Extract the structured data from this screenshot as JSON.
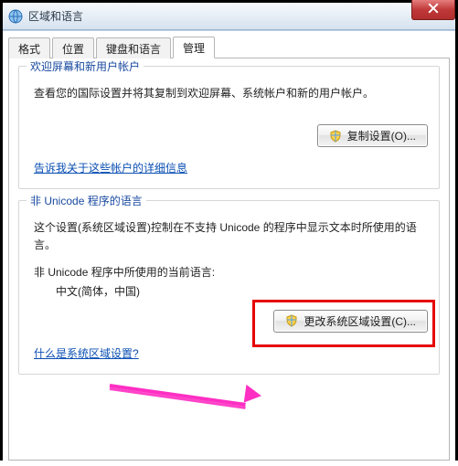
{
  "window": {
    "title": "区域和语言",
    "close_label": "X"
  },
  "tabs": {
    "format": "格式",
    "location": "位置",
    "keyboard": "键盘和语言",
    "admin": "管理"
  },
  "group1": {
    "title": "欢迎屏幕和新用户帐户",
    "desc": "查看您的国际设置并将其复制到欢迎屏幕、系统帐户和新的用户帐户。",
    "button": "复制设置(O)...",
    "link": "告诉我关于这些帐户的详细信息"
  },
  "group2": {
    "title": "非 Unicode 程序的语言",
    "desc": "这个设置(系统区域设置)控制在不支持 Unicode 的程序中显示文本时所使用的语言。",
    "current_label": "非 Unicode 程序中所使用的当前语言:",
    "current_value": "中文(简体，中国)",
    "button": "更改系统区域设置(C)...",
    "link": "什么是系统区域设置?"
  }
}
